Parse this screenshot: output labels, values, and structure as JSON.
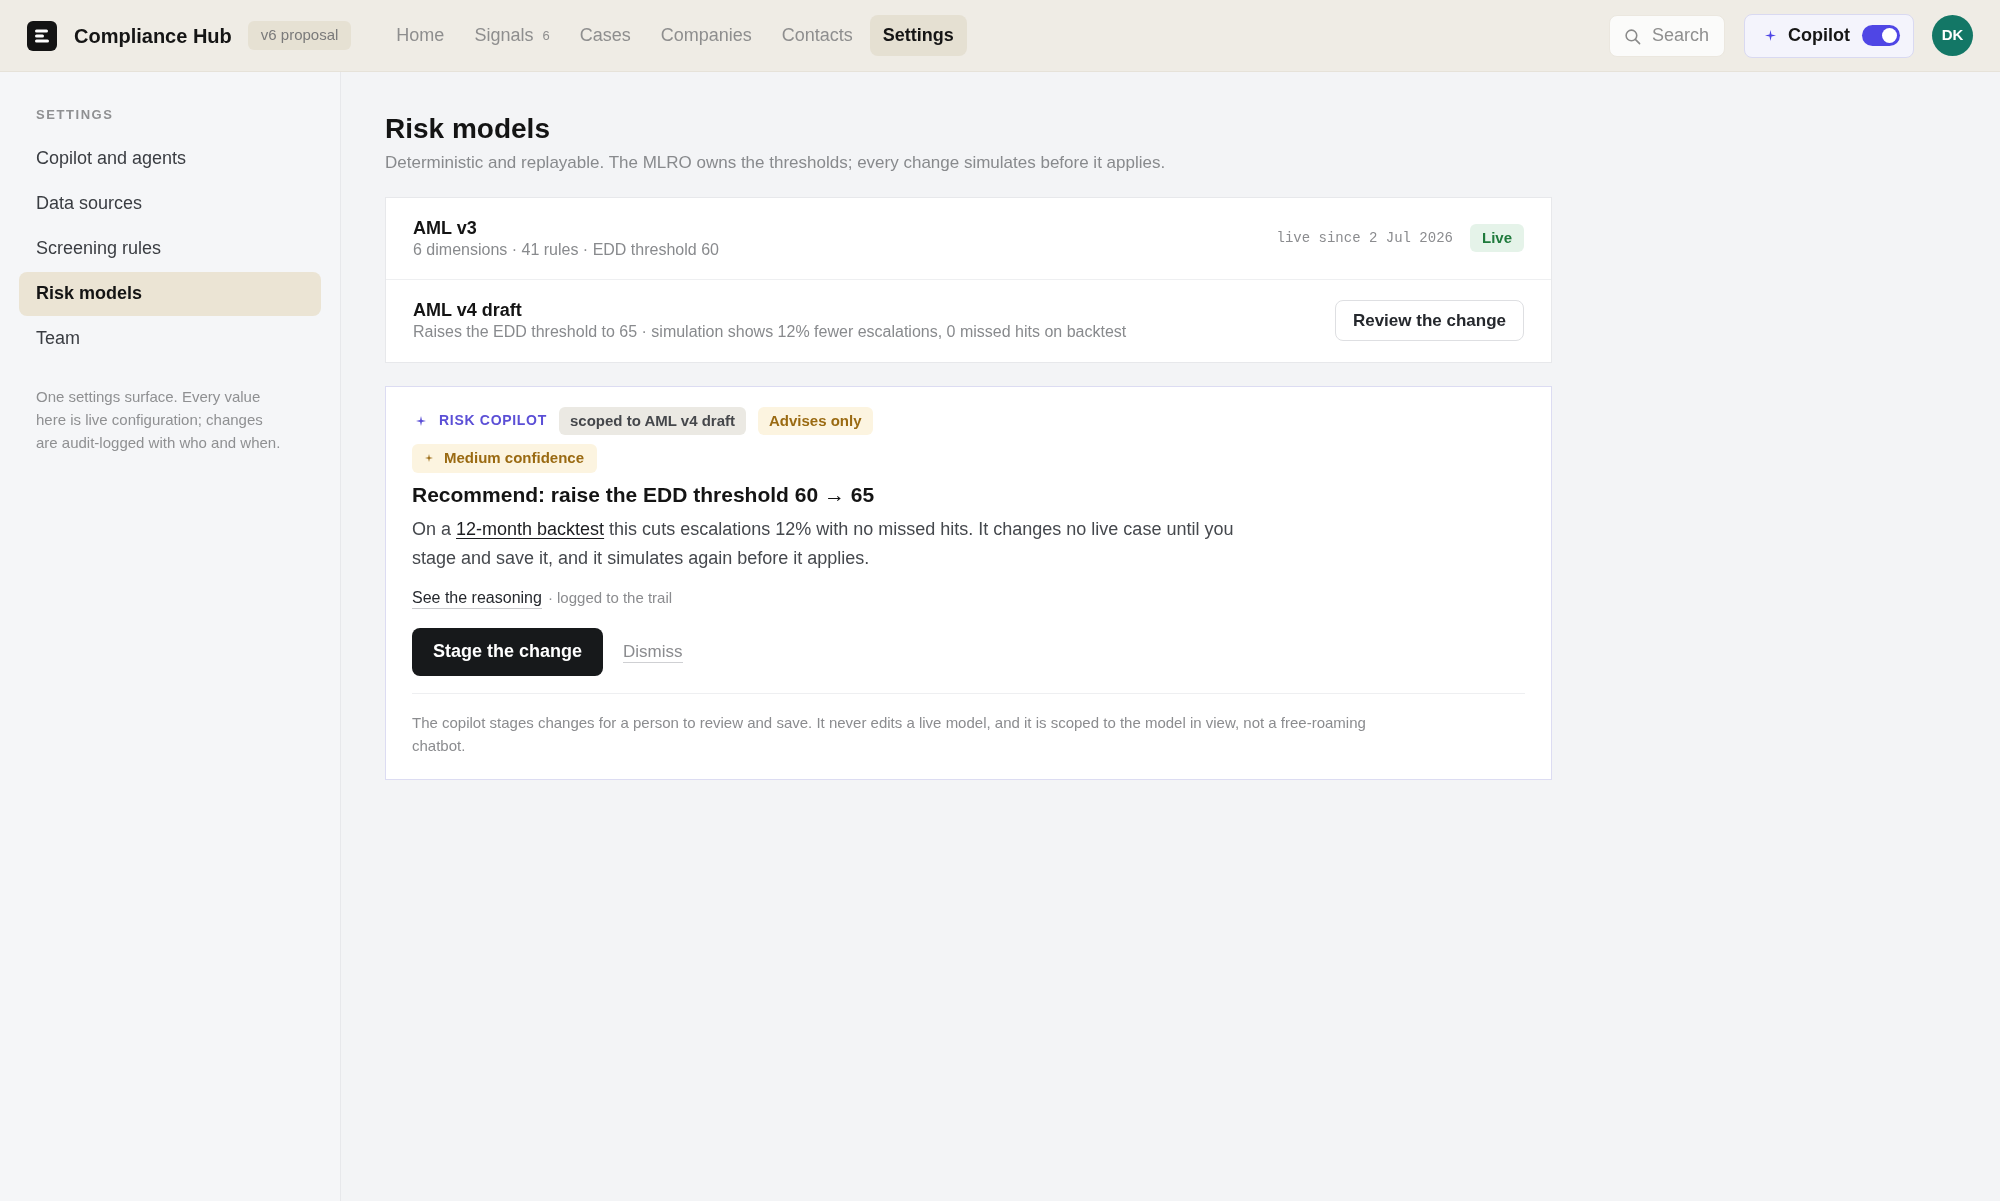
{
  "app": {
    "name": "Compliance Hub",
    "badge": "v6 proposal"
  },
  "nav": [
    {
      "label": "Home",
      "selected": false
    },
    {
      "label": "Signals",
      "count": "6",
      "selected": false
    },
    {
      "label": "Cases",
      "selected": false
    },
    {
      "label": "Companies",
      "selected": false
    },
    {
      "label": "Contacts",
      "selected": false
    },
    {
      "label": "Settings",
      "selected": true
    }
  ],
  "search": {
    "placeholder": "Search"
  },
  "copilot_toggle": {
    "label": "Copilot",
    "on": true
  },
  "avatar": {
    "initials": "DK"
  },
  "sidebar": {
    "heading": "SETTINGS",
    "items": [
      {
        "label": "Copilot and agents",
        "selected": false
      },
      {
        "label": "Data sources",
        "selected": false
      },
      {
        "label": "Screening rules",
        "selected": false
      },
      {
        "label": "Risk models",
        "selected": true
      },
      {
        "label": "Team",
        "selected": false
      }
    ],
    "note": "One settings surface. Every value here is live configuration; changes are audit-logged with who and when."
  },
  "page": {
    "title": "Risk models",
    "subtitle": "Deterministic and replayable. The MLRO owns the thresholds; every change simulates before it applies."
  },
  "models": [
    {
      "kind": "live",
      "name": "AML v3",
      "details": "6 dimensions · 41 rules · EDD threshold 60",
      "meta": "live since 2 Jul 2026",
      "status": "Live"
    },
    {
      "kind": "draft",
      "name": "AML v4 draft",
      "details": "Raises the EDD threshold to 65 · simulation shows 12% fewer escalations, 0 missed hits on backtest",
      "action": "Review the change"
    }
  ],
  "copilot": {
    "label": "RISK COPILOT",
    "tags": [
      {
        "kind": "scope",
        "text": "scoped to AML v4 draft"
      },
      {
        "kind": "advisory",
        "text": "Advises only"
      }
    ],
    "confidence": "Medium confidence",
    "heading": "Recommend: raise the EDD threshold 60 → 65",
    "body": {
      "before": "On a ",
      "link": "12-month backtest",
      "after": " this cuts escalations 12% with no missed hits. It changes no live case until you stage and save it, and it simulates again before it applies."
    },
    "reasoning_link": "See the reasoning",
    "reasoning_note": "· logged to the trail",
    "primary_action": "Stage the change",
    "secondary_action": "Dismiss",
    "footer": "The copilot stages changes for a person to review and save. It never edits a live model, and it is scoped to the model in view, not a free-roaming chatbot."
  }
}
